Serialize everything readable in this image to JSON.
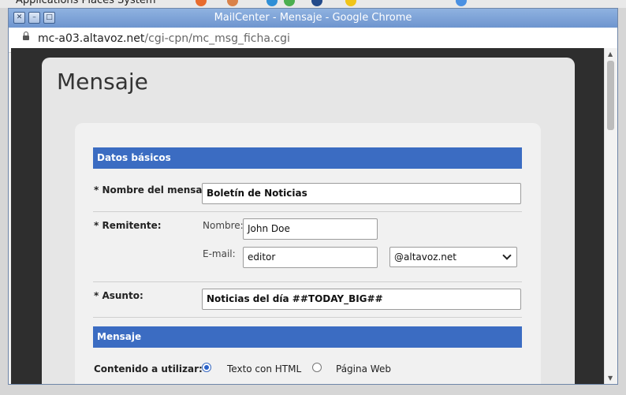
{
  "desktop": {
    "menu_text": "Applications   Places   System"
  },
  "window": {
    "title": "MailCenter - Mensaje - Google Chrome",
    "url_host": "mc-a03.altavoz.net",
    "url_path": "/cgi-cpn/mc_msg_ficha.cgi"
  },
  "page": {
    "heading": "Mensaje",
    "datos_section": "Datos básicos",
    "nombre_label": "* Nombre del mensaje:",
    "nombre_value": "Boletín de Noticias",
    "remitente_label": "* Remitente:",
    "sender_name_label": "Nombre:",
    "sender_name_value": "John Doe",
    "sender_email_label": "E-mail:",
    "sender_email_value": "editor",
    "domain_select_value": "@altavoz.net",
    "asunto_label": "* Asunto:",
    "asunto_value": "Noticias del día ##TODAY_BIG##",
    "mensaje_section": "Mensaje",
    "contenido_label": "Contenido a utilizar:",
    "option_html": "Texto con HTML",
    "option_web": "Página Web",
    "selected_option": "Texto con HTML"
  },
  "colors": {
    "accent": "#3b6cc2",
    "titlebar": "#7aa0d8"
  }
}
